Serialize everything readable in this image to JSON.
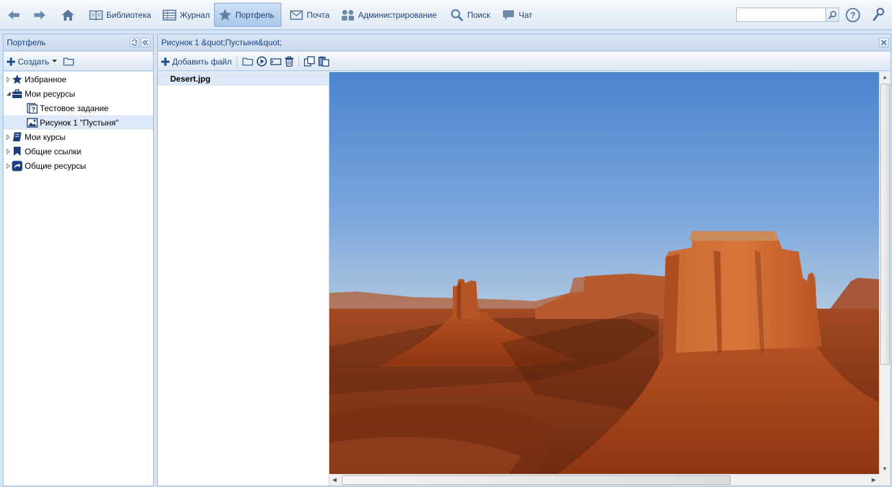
{
  "topbar": {
    "items": [
      {
        "label": "",
        "icon": "back-arrow-icon"
      },
      {
        "label": "",
        "icon": "forward-arrow-icon"
      },
      {
        "label": "",
        "icon": "home-icon"
      },
      {
        "label": "Библиотека",
        "icon": "book-icon"
      },
      {
        "label": "Журнал",
        "icon": "table-icon"
      },
      {
        "label": "Портфель",
        "icon": "star-icon",
        "active": true
      },
      {
        "label": "Почта",
        "icon": "mail-icon"
      },
      {
        "label": "Администрирование",
        "icon": "admin-icon"
      },
      {
        "label": "Поиск",
        "icon": "magnifier-icon"
      },
      {
        "label": "Чат",
        "icon": "chat-icon"
      }
    ],
    "search_value": "",
    "help_icon": "help-icon",
    "settings_icon": "wrench-icon"
  },
  "left_panel": {
    "title": "Портфель",
    "create_label": "Создать",
    "tree": [
      {
        "label": "Избранное",
        "icon": "star-icon",
        "expander": "collapsed",
        "level": 0
      },
      {
        "label": "Мои ресурсы",
        "icon": "briefcase-icon",
        "expander": "expanded",
        "level": 0
      },
      {
        "label": "Тестовое задание",
        "icon": "quiz-icon",
        "expander": "none",
        "level": 1
      },
      {
        "label": "Рисунок 1 \"Пустыня\"",
        "icon": "image-icon",
        "expander": "none",
        "level": 1,
        "selected": true
      },
      {
        "label": "Мои курсы",
        "icon": "courses-icon",
        "expander": "collapsed",
        "level": 0
      },
      {
        "label": "Общие ссылки",
        "icon": "bookmark-icon",
        "expander": "collapsed",
        "level": 0
      },
      {
        "label": "Общие ресурсы",
        "icon": "share-icon",
        "expander": "collapsed",
        "level": 0
      }
    ]
  },
  "main_panel": {
    "title": "Рисунок 1 &quot;Пустыня&quot;",
    "add_file_label": "Добавить файл",
    "files": [
      "Desert.jpg"
    ]
  },
  "colors": {
    "header_text": "#15428b",
    "border": "#99bbe8",
    "selection": "#dfe8f6"
  }
}
